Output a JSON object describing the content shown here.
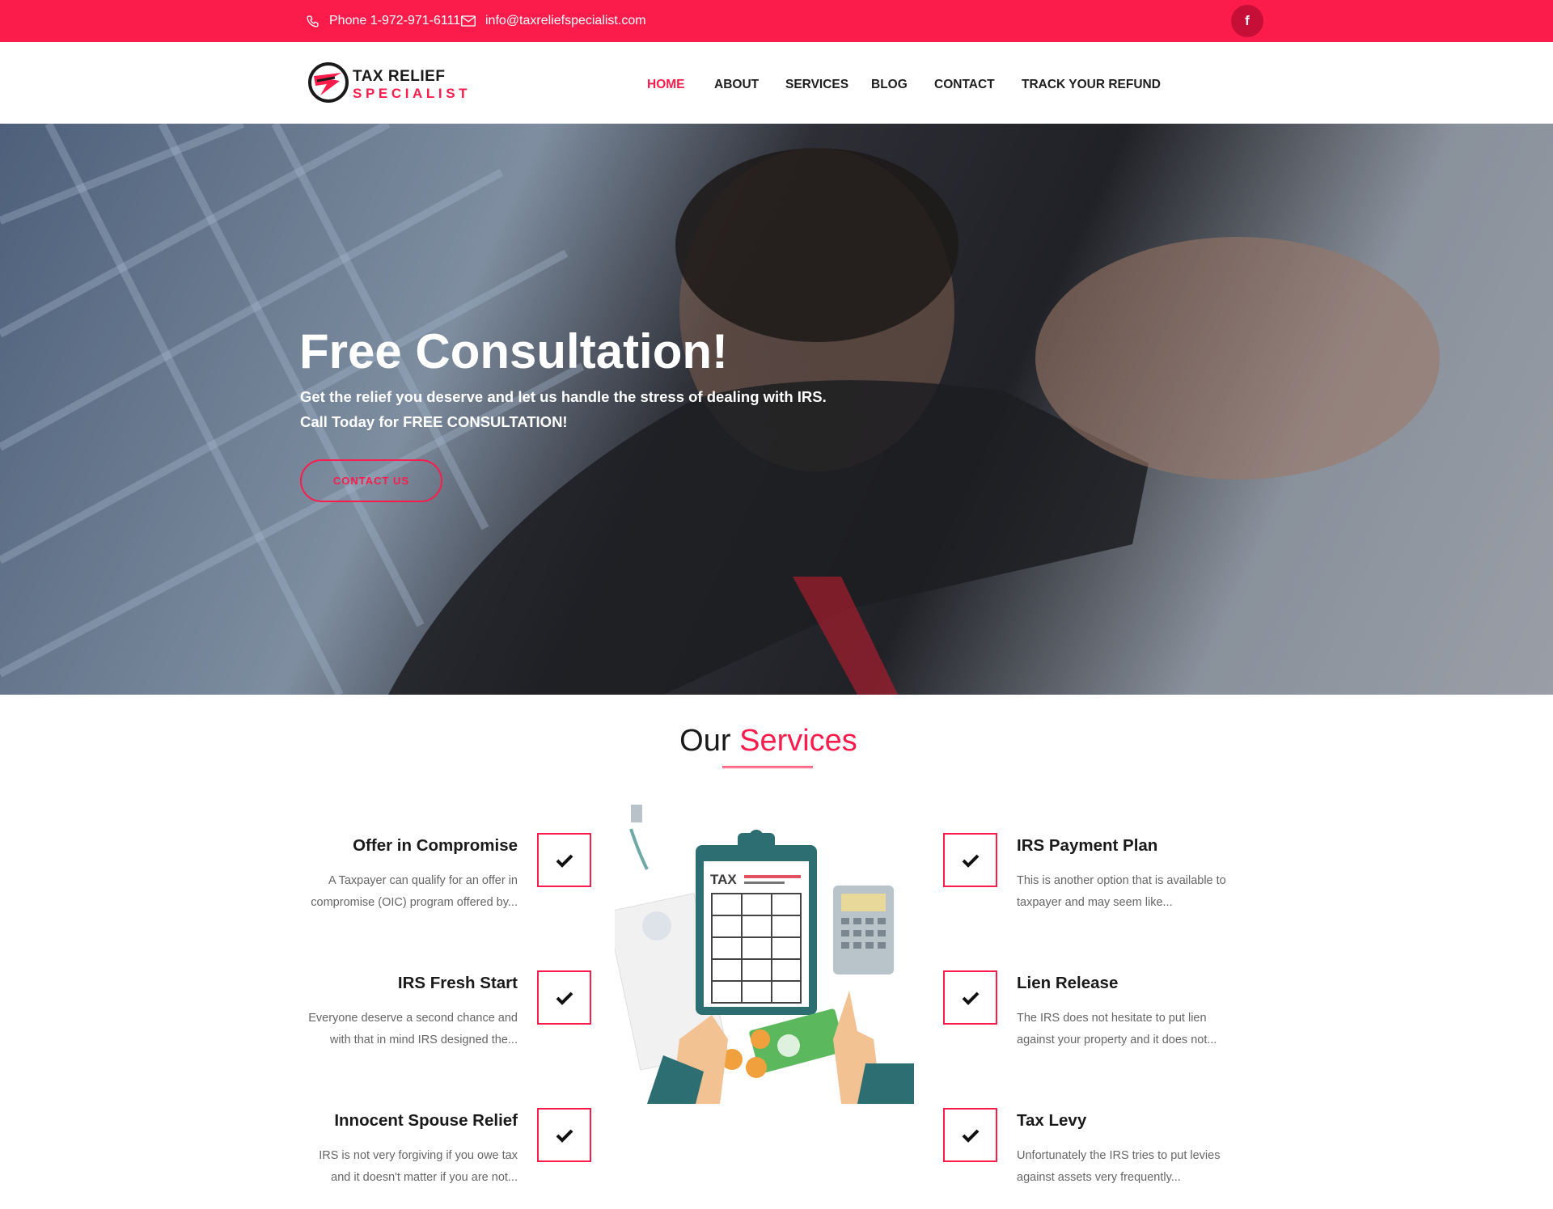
{
  "topbar": {
    "phone": "Phone 1-972-971-6111",
    "email": "info@taxreliefspecialist.com",
    "facebook_icon": "facebook-icon",
    "accent_color": "#fc1c4b"
  },
  "logo": {
    "line1": "TAX RELIEF",
    "line2": "SPECIALIST"
  },
  "nav": {
    "items": [
      "HOME",
      "ABOUT",
      "SERVICES",
      "BLOG",
      "CONTACT",
      "TRACK YOUR REFUND"
    ],
    "active": "HOME"
  },
  "hero": {
    "title": "Free Consultation!",
    "line1": "Get the relief you deserve and let us handle the stress of dealing with IRS.",
    "line2": "Call Today for FREE CONSULTATION!",
    "button": "CONTACT US"
  },
  "services": {
    "title_part1": "Our",
    "title_part2": "Services",
    "left": [
      {
        "title": "Offer in Compromise",
        "desc1": "A Taxpayer can qualify for an offer in",
        "desc2": "compromise (OIC) program offered by..."
      },
      {
        "title": "IRS Fresh Start",
        "desc1": "Everyone deserve a second chance and",
        "desc2": "with that in mind IRS designed the..."
      },
      {
        "title": "Innocent Spouse Relief",
        "desc1": "IRS is not very forgiving if you owe tax",
        "desc2": "and it doesn't matter if you are not..."
      }
    ],
    "right": [
      {
        "title": "IRS Payment Plan",
        "desc1": "This is another option that is available to",
        "desc2": "taxpayer and may seem like..."
      },
      {
        "title": "Lien Release",
        "desc1": "The IRS does not hesitate to put lien",
        "desc2": "against your property and it does not..."
      },
      {
        "title": "Tax Levy",
        "desc1": "Unfortunately the IRS tries to put levies",
        "desc2": "against assets very frequently..."
      }
    ],
    "illustration_label": "TAX"
  }
}
